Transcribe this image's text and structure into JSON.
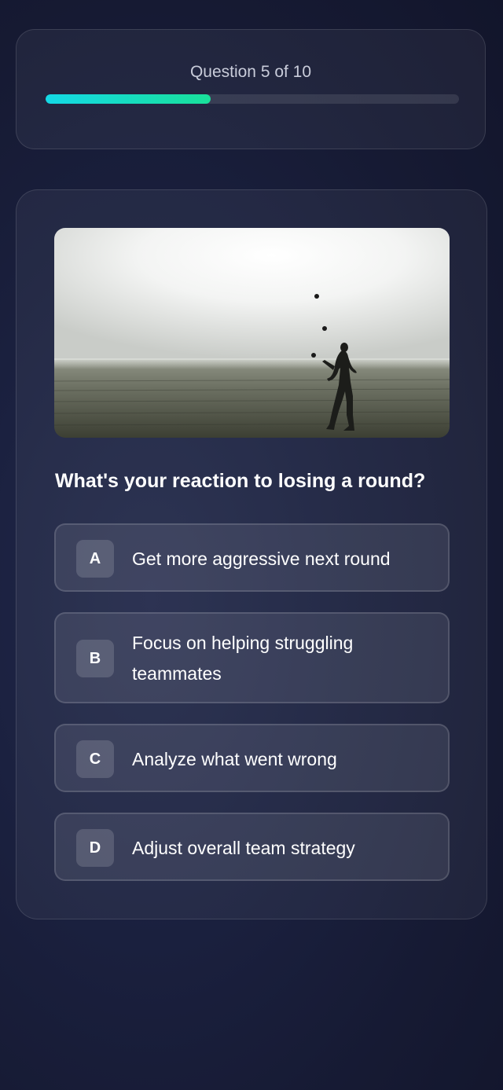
{
  "progress": {
    "label": "Question 5 of 10",
    "current": 5,
    "total": 10,
    "fraction": 0.4,
    "fill_colors": [
      "#14d9e6",
      "#19e09a"
    ]
  },
  "question": {
    "image_subject": "silhouette of a person juggling three balls on an open field under a bright sky",
    "text": "What's your reaction to losing a round?"
  },
  "options": [
    {
      "letter": "A",
      "label": "Get more aggressive next round"
    },
    {
      "letter": "B",
      "label": "Focus on helping struggling teammates"
    },
    {
      "letter": "C",
      "label": "Analyze what went wrong"
    },
    {
      "letter": "D",
      "label": "Adjust overall team strategy"
    }
  ]
}
